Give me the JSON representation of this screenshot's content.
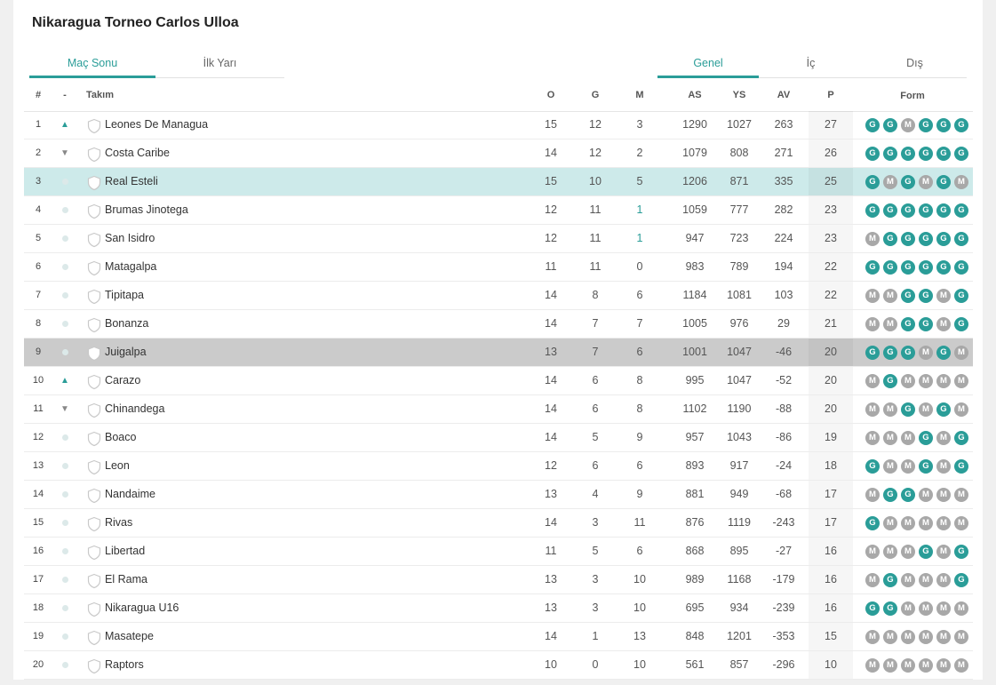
{
  "page": {
    "title": "Nikaragua Torneo Carlos Ulloa"
  },
  "tabs_left": [
    {
      "label": "Maç Sonu",
      "active": true
    },
    {
      "label": "İlk Yarı",
      "active": false
    }
  ],
  "tabs_right": [
    {
      "label": "Genel",
      "active": true
    },
    {
      "label": "İç",
      "active": false
    },
    {
      "label": "Dış",
      "active": false
    }
  ],
  "columns": {
    "rank": "#",
    "move": "-",
    "team": "Takım",
    "o": "O",
    "g": "G",
    "m": "M",
    "as": "AS",
    "ys": "YS",
    "av": "AV",
    "p": "P",
    "form": "Form"
  },
  "rows": [
    {
      "rank": "1",
      "move": "up",
      "team": "Leones De Managua",
      "o": "15",
      "g": "12",
      "m": "3",
      "as": "1290",
      "ys": "1027",
      "av": "263",
      "p": "27",
      "form": [
        "G",
        "G",
        "M",
        "G",
        "G",
        "G"
      ],
      "highlight": ""
    },
    {
      "rank": "2",
      "move": "down",
      "team": "Costa Caribe",
      "o": "14",
      "g": "12",
      "m": "2",
      "as": "1079",
      "ys": "808",
      "av": "271",
      "p": "26",
      "form": [
        "G",
        "G",
        "G",
        "G",
        "G",
        "G"
      ],
      "highlight": ""
    },
    {
      "rank": "3",
      "move": "same",
      "team": "Real Esteli",
      "o": "15",
      "g": "10",
      "m": "5",
      "as": "1206",
      "ys": "871",
      "av": "335",
      "p": "25",
      "form": [
        "G",
        "M",
        "G",
        "M",
        "G",
        "M"
      ],
      "highlight": "teal"
    },
    {
      "rank": "4",
      "move": "same",
      "team": "Brumas Jinotega",
      "o": "12",
      "g": "11",
      "m": "1",
      "as": "1059",
      "ys": "777",
      "av": "282",
      "p": "23",
      "form": [
        "G",
        "G",
        "G",
        "G",
        "G",
        "G"
      ],
      "highlight": ""
    },
    {
      "rank": "5",
      "move": "same",
      "team": "San Isidro",
      "o": "12",
      "g": "11",
      "m": "1",
      "as": "947",
      "ys": "723",
      "av": "224",
      "p": "23",
      "form": [
        "M",
        "G",
        "G",
        "G",
        "G",
        "G"
      ],
      "highlight": ""
    },
    {
      "rank": "6",
      "move": "same",
      "team": "Matagalpa",
      "o": "11",
      "g": "11",
      "m": "0",
      "as": "983",
      "ys": "789",
      "av": "194",
      "p": "22",
      "form": [
        "G",
        "G",
        "G",
        "G",
        "G",
        "G"
      ],
      "highlight": ""
    },
    {
      "rank": "7",
      "move": "same",
      "team": "Tipitapa",
      "o": "14",
      "g": "8",
      "m": "6",
      "as": "1184",
      "ys": "1081",
      "av": "103",
      "p": "22",
      "form": [
        "M",
        "M",
        "G",
        "G",
        "M",
        "G"
      ],
      "highlight": ""
    },
    {
      "rank": "8",
      "move": "same",
      "team": "Bonanza",
      "o": "14",
      "g": "7",
      "m": "7",
      "as": "1005",
      "ys": "976",
      "av": "29",
      "p": "21",
      "form": [
        "M",
        "M",
        "G",
        "G",
        "M",
        "G"
      ],
      "highlight": ""
    },
    {
      "rank": "9",
      "move": "same",
      "team": "Juigalpa",
      "o": "13",
      "g": "7",
      "m": "6",
      "as": "1001",
      "ys": "1047",
      "av": "-46",
      "p": "20",
      "form": [
        "G",
        "G",
        "G",
        "M",
        "G",
        "M"
      ],
      "highlight": "grey"
    },
    {
      "rank": "10",
      "move": "up",
      "team": "Carazo",
      "o": "14",
      "g": "6",
      "m": "8",
      "as": "995",
      "ys": "1047",
      "av": "-52",
      "p": "20",
      "form": [
        "M",
        "G",
        "M",
        "M",
        "M",
        "M"
      ],
      "highlight": ""
    },
    {
      "rank": "11",
      "move": "down",
      "team": "Chinandega",
      "o": "14",
      "g": "6",
      "m": "8",
      "as": "1102",
      "ys": "1190",
      "av": "-88",
      "p": "20",
      "form": [
        "M",
        "M",
        "G",
        "M",
        "G",
        "M"
      ],
      "highlight": ""
    },
    {
      "rank": "12",
      "move": "same",
      "team": "Boaco",
      "o": "14",
      "g": "5",
      "m": "9",
      "as": "957",
      "ys": "1043",
      "av": "-86",
      "p": "19",
      "form": [
        "M",
        "M",
        "M",
        "G",
        "M",
        "G"
      ],
      "highlight": ""
    },
    {
      "rank": "13",
      "move": "same",
      "team": "Leon",
      "o": "12",
      "g": "6",
      "m": "6",
      "as": "893",
      "ys": "917",
      "av": "-24",
      "p": "18",
      "form": [
        "G",
        "M",
        "M",
        "G",
        "M",
        "G"
      ],
      "highlight": ""
    },
    {
      "rank": "14",
      "move": "same",
      "team": "Nandaime",
      "o": "13",
      "g": "4",
      "m": "9",
      "as": "881",
      "ys": "949",
      "av": "-68",
      "p": "17",
      "form": [
        "M",
        "G",
        "G",
        "M",
        "M",
        "M"
      ],
      "highlight": ""
    },
    {
      "rank": "15",
      "move": "same",
      "team": "Rivas",
      "o": "14",
      "g": "3",
      "m": "11",
      "as": "876",
      "ys": "1119",
      "av": "-243",
      "p": "17",
      "form": [
        "G",
        "M",
        "M",
        "M",
        "M",
        "M"
      ],
      "highlight": ""
    },
    {
      "rank": "16",
      "move": "same",
      "team": "Libertad",
      "o": "11",
      "g": "5",
      "m": "6",
      "as": "868",
      "ys": "895",
      "av": "-27",
      "p": "16",
      "form": [
        "M",
        "M",
        "M",
        "G",
        "M",
        "G"
      ],
      "highlight": ""
    },
    {
      "rank": "17",
      "move": "same",
      "team": "El Rama",
      "o": "13",
      "g": "3",
      "m": "10",
      "as": "989",
      "ys": "1168",
      "av": "-179",
      "p": "16",
      "form": [
        "M",
        "G",
        "M",
        "M",
        "M",
        "G"
      ],
      "highlight": ""
    },
    {
      "rank": "18",
      "move": "same",
      "team": "Nikaragua U16",
      "o": "13",
      "g": "3",
      "m": "10",
      "as": "695",
      "ys": "934",
      "av": "-239",
      "p": "16",
      "form": [
        "G",
        "G",
        "M",
        "M",
        "M",
        "M"
      ],
      "highlight": ""
    },
    {
      "rank": "19",
      "move": "same",
      "team": "Masatepe",
      "o": "14",
      "g": "1",
      "m": "13",
      "as": "848",
      "ys": "1201",
      "av": "-353",
      "p": "15",
      "form": [
        "M",
        "M",
        "M",
        "M",
        "M",
        "M"
      ],
      "highlight": ""
    },
    {
      "rank": "20",
      "move": "same",
      "team": "Raptors",
      "o": "10",
      "g": "0",
      "m": "10",
      "as": "561",
      "ys": "857",
      "av": "-296",
      "p": "10",
      "form": [
        "M",
        "M",
        "M",
        "M",
        "M",
        "M"
      ],
      "highlight": ""
    }
  ]
}
